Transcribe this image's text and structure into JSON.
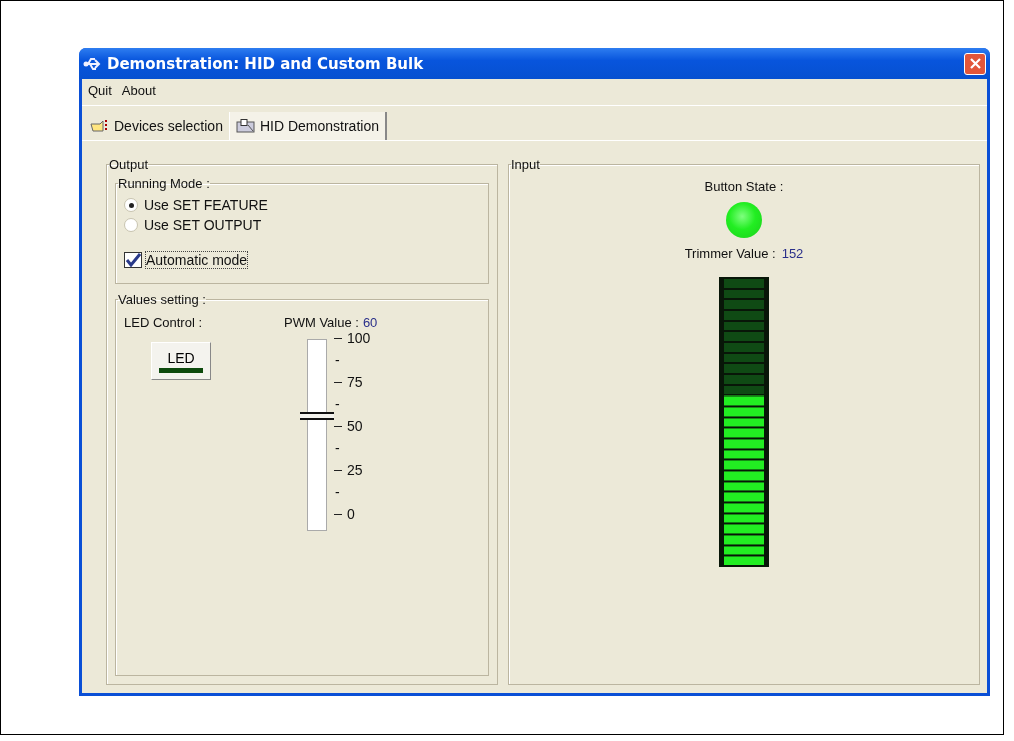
{
  "window": {
    "title": "Demonstration: HID and Custom Bulk"
  },
  "menu": [
    "Quit",
    "About"
  ],
  "tabs": [
    {
      "label": "Devices selection",
      "selected": false
    },
    {
      "label": "HID Demonstration",
      "selected": true
    }
  ],
  "output": {
    "title": "Output",
    "running_mode": {
      "title": "Running Mode :",
      "options": [
        {
          "label": "Use SET FEATURE",
          "selected": true
        },
        {
          "label": "Use SET OUTPUT",
          "selected": false
        }
      ],
      "automatic_mode": {
        "label": "Automatic mode",
        "checked": true
      }
    },
    "values_setting": {
      "title": "Values setting :",
      "led_control": {
        "label": "LED Control :",
        "button": "LED",
        "on": false
      },
      "pwm": {
        "label": "PWM Value :",
        "value": "60",
        "level": 0.6,
        "scale": [
          "100",
          "-",
          "75",
          "-",
          "50",
          "-",
          "25",
          "-",
          "0"
        ]
      }
    }
  },
  "input": {
    "title": "Input",
    "button_state": {
      "label": "Button State :",
      "on": true
    },
    "trimmer": {
      "label": "Trimmer Value :",
      "value": "152",
      "level": 0.596
    }
  }
}
